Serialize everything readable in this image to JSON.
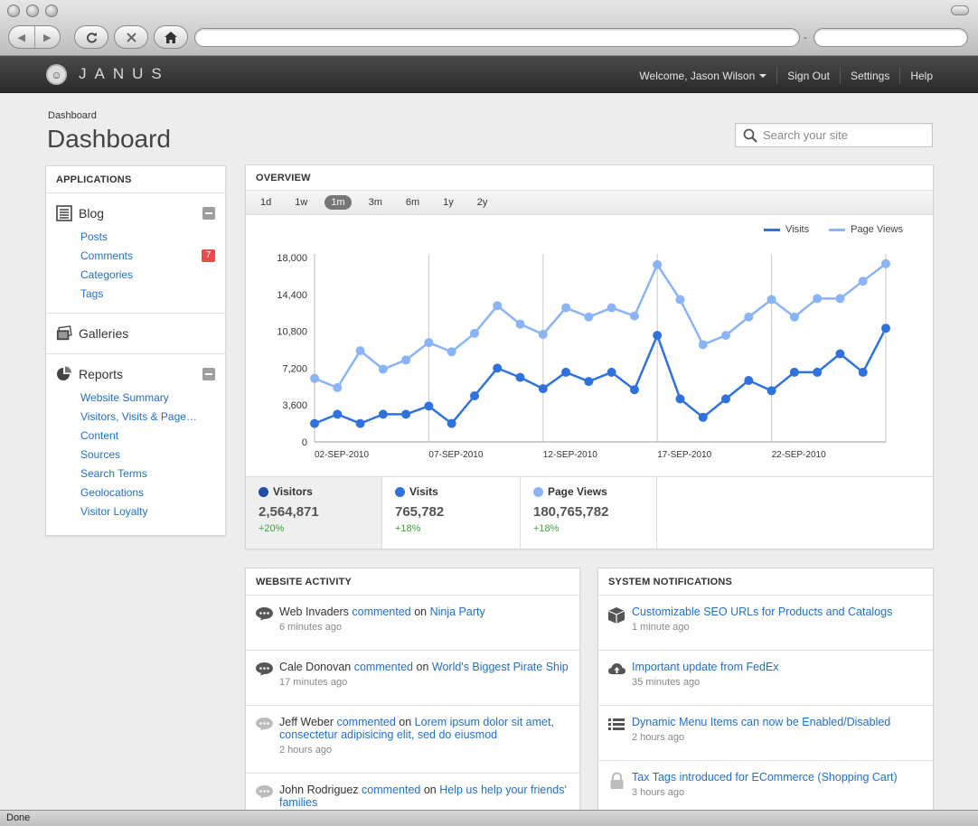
{
  "browser": {
    "url": "",
    "search": "",
    "status": "Done"
  },
  "header": {
    "logo": "JANUS",
    "welcome": "Welcome, Jason Wilson",
    "nav": [
      "Sign Out",
      "Settings",
      "Help"
    ]
  },
  "page": {
    "breadcrumb": "Dashboard",
    "title": "Dashboard",
    "search_placeholder": "Search your site"
  },
  "sidebar": {
    "heading": "APPLICATIONS",
    "blog": {
      "label": "Blog",
      "items": [
        "Posts",
        "Comments",
        "Categories",
        "Tags"
      ],
      "comments_badge": "7"
    },
    "galleries": {
      "label": "Galleries"
    },
    "reports": {
      "label": "Reports",
      "items": [
        "Website Summary",
        "Visitors, Visits & Page…",
        "Content",
        "Sources",
        "Search Terms",
        "Geolocations",
        "Visitor Loyalty"
      ]
    }
  },
  "overview": {
    "heading": "OVERVIEW",
    "ranges": [
      "1d",
      "1w",
      "1m",
      "3m",
      "6m",
      "1y",
      "2y"
    ],
    "active_range": "1m",
    "stats": [
      {
        "label": "Visitors",
        "value": "2,564,871",
        "change": "+20%",
        "color": "#1f4ea8"
      },
      {
        "label": "Visits",
        "value": "765,782",
        "change": "+18%",
        "color": "#2f72dd"
      },
      {
        "label": "Page Views",
        "value": "180,765,782",
        "change": "+18%",
        "color": "#8ab4f5"
      }
    ]
  },
  "chart_data": {
    "type": "line",
    "title": "",
    "xlabel": "",
    "ylabel": "",
    "ylim": [
      0,
      18000
    ],
    "yticks": [
      "0",
      "3,600",
      "7,200",
      "10,800",
      "14,400",
      "18,000"
    ],
    "x_tick_labels": [
      "02-SEP-2010",
      "07-SEP-2010",
      "12-SEP-2010",
      "17-SEP-2010",
      "22-SEP-2010"
    ],
    "x_tick_index": [
      0,
      5,
      10,
      15,
      20
    ],
    "legend": "top-right",
    "series": [
      {
        "name": "Visits",
        "color": "#2f72dd",
        "values": [
          1800,
          2700,
          1800,
          2700,
          2700,
          3500,
          1800,
          4500,
          7200,
          6300,
          5200,
          6800,
          5900,
          6800,
          5100,
          10400,
          4200,
          2400,
          4200,
          6000,
          5000,
          6800,
          6800,
          8600,
          6800,
          11100
        ]
      },
      {
        "name": "Page Views",
        "color": "#8ab4f5",
        "values": [
          6200,
          5300,
          8900,
          7100,
          8000,
          9700,
          8800,
          10600,
          13300,
          11500,
          10500,
          13100,
          12200,
          13100,
          12300,
          17300,
          13900,
          9500,
          10400,
          12200,
          13900,
          12200,
          14000,
          14000,
          15700,
          17400
        ]
      }
    ]
  },
  "activity": {
    "heading": "WEBSITE ACTIVITY",
    "items": [
      {
        "user": "Web Invaders",
        "action": "commented",
        "on": "on",
        "target": "Ninja Party",
        "time": "6 minutes ago"
      },
      {
        "user": "Cale Donovan",
        "action": "commented",
        "on": "on",
        "target": "World's Biggest Pirate Ship",
        "time": "17 minutes ago"
      },
      {
        "user": "Jeff Weber",
        "action": "commented",
        "on": "on",
        "target": "Lorem ipsum dolor sit amet, consectetur adipisicing elit, sed do eiusmod",
        "time": "2 hours ago"
      },
      {
        "user": "John Rodriguez",
        "action": "commented",
        "on": "on",
        "target": "Help us help your friends' families",
        "time": ""
      }
    ]
  },
  "notifications": {
    "heading": "SYSTEM NOTIFICATIONS",
    "items": [
      {
        "icon": "cube-icon",
        "title": "Customizable SEO URLs for Products and Catalogs",
        "time": "1 minute ago"
      },
      {
        "icon": "cloud-upload-icon",
        "title": "Important update from FedEx",
        "time": "35 minutes ago"
      },
      {
        "icon": "list-icon",
        "title": "Dynamic Menu Items can now be Enabled/Disabled",
        "time": "2 hours ago"
      },
      {
        "icon": "lock-icon",
        "title": "Tax Tags introduced for ECommerce (Shopping Cart)",
        "time": "3 hours ago"
      }
    ]
  }
}
